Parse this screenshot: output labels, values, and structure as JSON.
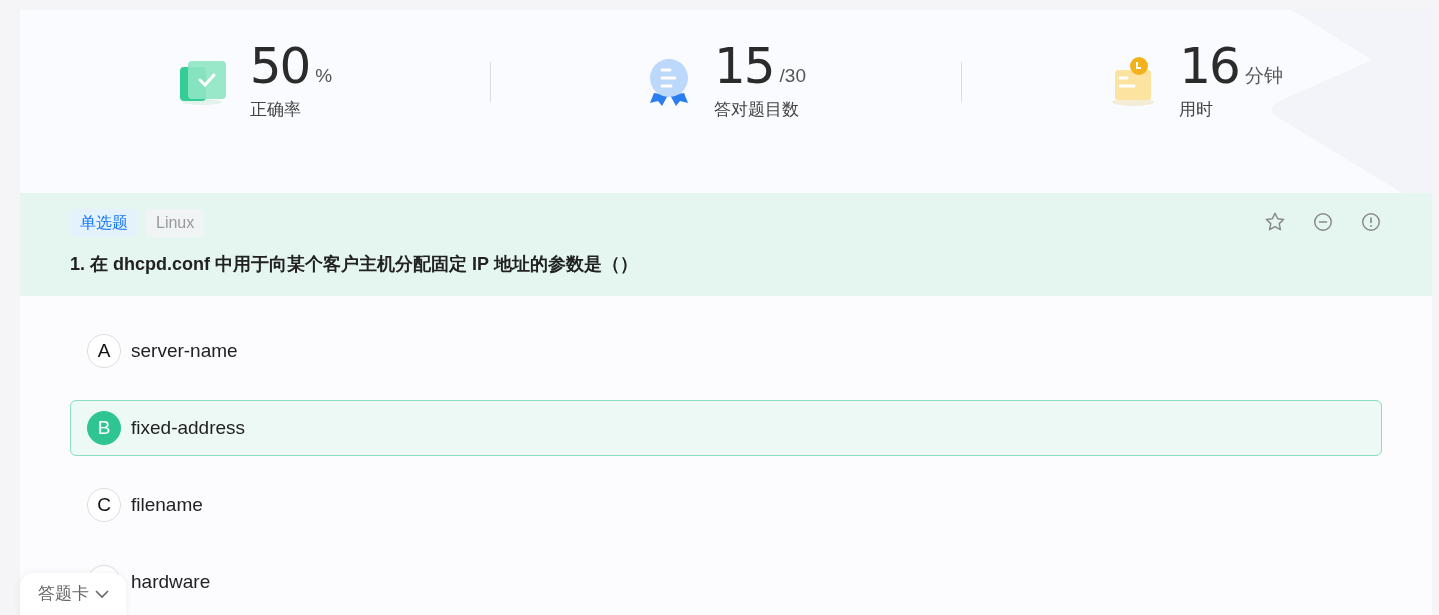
{
  "stats": [
    {
      "kind": "accuracy",
      "value": "50",
      "unit": "%",
      "label": "正确率"
    },
    {
      "kind": "correct",
      "value": "15",
      "unit": "/30",
      "label": "答对题目数"
    },
    {
      "kind": "time",
      "value": "16",
      "unit": "分钟",
      "label": "用时"
    }
  ],
  "question": {
    "tags": [
      {
        "kind": "type",
        "text": "单选题"
      },
      {
        "kind": "subject",
        "text": "Linux"
      }
    ],
    "title": "1. 在 dhcpd.conf 中用于向某个客户主机分配固定 IP 地址的参数是（）",
    "options": [
      {
        "letter": "A",
        "text": "server-name",
        "selected": false
      },
      {
        "letter": "B",
        "text": "fixed-address",
        "selected": true
      },
      {
        "letter": "C",
        "text": "filename",
        "selected": false
      },
      {
        "text": "hardware",
        "selected": false
      }
    ]
  },
  "answer_card": {
    "label": "答题卡"
  }
}
